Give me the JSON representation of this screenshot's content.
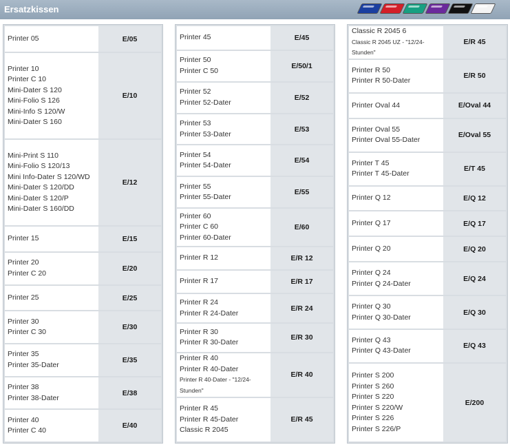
{
  "header": {
    "title": "Ersatzkissen",
    "colors": [
      "#1a3fa0",
      "#d31f28",
      "#17a082",
      "#6b2a9c",
      "#111111",
      "#f4f4f4"
    ]
  },
  "columns": [
    {
      "rows": [
        {
          "lines": [
            "Printer 05"
          ],
          "code": "E/05",
          "weight": 2.3
        },
        {
          "lines": [
            "Printer 10",
            "Printer C 10",
            "Mini-Dater S 120",
            "Mini-Folio S 126",
            "Mini-Info S 120/W",
            "Mini-Dater S 160"
          ],
          "code": "E/10",
          "weight": 7.6
        },
        {
          "lines": [
            "Mini-Print S 110",
            "Mini-Folio S 120/13",
            "Mini Info-Dater S 120/WD",
            "Mini-Dater S 120/DD",
            "Mini-Dater S 120/P",
            "Mini-Dater S 160/DD"
          ],
          "code": "E/12",
          "weight": 7.6
        },
        {
          "lines": [
            "Printer 15"
          ],
          "code": "E/15",
          "weight": 2.2
        },
        {
          "lines": [
            "Printer 20",
            "Printer C 20"
          ],
          "code": "E/20",
          "weight": 2.8
        },
        {
          "lines": [
            "Printer 25"
          ],
          "code": "E/25",
          "weight": 2.2
        },
        {
          "lines": [
            "Printer 30",
            "Printer C 30"
          ],
          "code": "E/30",
          "weight": 2.8
        },
        {
          "lines": [
            "Printer 35",
            "Printer 35-Dater"
          ],
          "code": "E/35",
          "weight": 2.8
        },
        {
          "lines": [
            "Printer 38",
            "Printer 38-Dater"
          ],
          "code": "E/38",
          "weight": 2.8
        },
        {
          "lines": [
            "Printer 40",
            "Printer C 40"
          ],
          "code": "E/40",
          "weight": 2.8
        }
      ]
    },
    {
      "rows": [
        {
          "lines": [
            "Printer 45"
          ],
          "code": "E/45",
          "weight": 2.1
        },
        {
          "lines": [
            "Printer 50",
            "Printer C 50"
          ],
          "code": "E/50/1",
          "weight": 2.7
        },
        {
          "lines": [
            "Printer 52",
            "Printer 52-Dater"
          ],
          "code": "E/52",
          "weight": 2.7
        },
        {
          "lines": [
            "Printer 53",
            "Printer 53-Dater"
          ],
          "code": "E/53",
          "weight": 2.7
        },
        {
          "lines": [
            "Printer 54",
            "Printer 54-Dater"
          ],
          "code": "E/54",
          "weight": 2.7
        },
        {
          "lines": [
            "Printer 55",
            "Printer 55-Dater"
          ],
          "code": "E/55",
          "weight": 2.7
        },
        {
          "lines": [
            "Printer 60",
            "Printer C 60",
            "Printer 60-Dater"
          ],
          "code": "E/60",
          "weight": 3.3
        },
        {
          "lines": [
            "Printer R 12"
          ],
          "code": "E/R 12",
          "weight": 2.0
        },
        {
          "lines": [
            "Printer R 17"
          ],
          "code": "E/R 17",
          "weight": 2.0
        },
        {
          "lines": [
            "Printer R 24",
            "Printer R 24-Dater"
          ],
          "code": "E/R 24",
          "weight": 2.5
        },
        {
          "lines": [
            "Printer R 30",
            "Printer R 30-Dater"
          ],
          "code": "E/R 30",
          "weight": 2.5
        },
        {
          "lines": [
            "Printer R 40",
            "Printer R 40-Dater",
            "Printer R 40-Dater - \"12/24-Stunden\""
          ],
          "code": "E/R 40",
          "weight": 3.9,
          "small_last": true
        },
        {
          "lines": [
            "Printer R 45",
            "Printer R 45-Dater",
            "Classic R 2045"
          ],
          "code": "E/R 45",
          "weight": 3.9
        }
      ]
    },
    {
      "rows": [
        {
          "lines": [
            "Classic R 2045 6",
            "Classic R 2045 UZ - \"12/24-Stunden\""
          ],
          "code": "E/R 45",
          "weight": 2.7,
          "small_last": true
        },
        {
          "lines": [
            "Printer R 50",
            "Printer R 50-Dater"
          ],
          "code": "E/R 50",
          "weight": 2.7
        },
        {
          "lines": [
            "Printer Oval 44"
          ],
          "code": "E/Oval 44",
          "weight": 2.0
        },
        {
          "lines": [
            "Printer Oval 55",
            "Printer Oval 55-Dater"
          ],
          "code": "E/Oval 55",
          "weight": 2.7
        },
        {
          "lines": [
            "Printer T 45",
            "Printer T 45-Dater"
          ],
          "code": "E/T 45",
          "weight": 2.7
        },
        {
          "lines": [
            "Printer Q 12"
          ],
          "code": "E/Q 12",
          "weight": 2.0
        },
        {
          "lines": [
            "Printer Q 17"
          ],
          "code": "E/Q 17",
          "weight": 2.0
        },
        {
          "lines": [
            "Printer Q 20"
          ],
          "code": "E/Q 20",
          "weight": 2.0
        },
        {
          "lines": [
            "Printer Q 24",
            "Printer Q 24-Dater"
          ],
          "code": "E/Q 24",
          "weight": 2.7
        },
        {
          "lines": [
            "Printer Q 30",
            "Printer Q 30-Dater"
          ],
          "code": "E/Q 30",
          "weight": 2.7
        },
        {
          "lines": [
            "Printer Q 43",
            "Printer Q 43-Dater"
          ],
          "code": "E/Q 43",
          "weight": 2.7
        },
        {
          "lines": [
            "Printer S 200",
            "Printer S 260",
            "Printer S 220",
            "Printer S 220/W",
            "Printer S 226",
            "Printer S 226/P"
          ],
          "code": "E/200",
          "weight": 6.5
        }
      ]
    }
  ]
}
